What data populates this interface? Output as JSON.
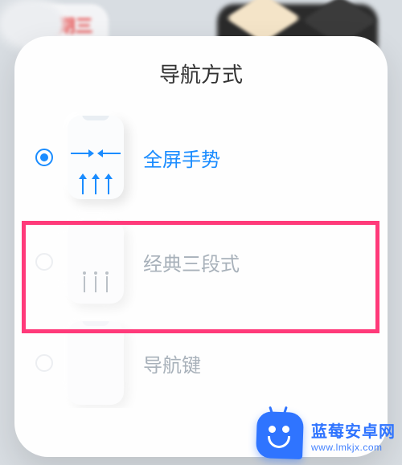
{
  "background": {
    "date_widget_label": "星期三"
  },
  "sheet": {
    "title": "导航方式",
    "options": [
      {
        "id": "fullscreen-gesture",
        "label": "全屏手势",
        "selected": true
      },
      {
        "id": "classic-three",
        "label": "经典三段式",
        "selected": false
      },
      {
        "id": "nav-keys",
        "label": "导航键",
        "selected": false
      }
    ]
  },
  "annotation": {
    "highlight_color": "#ff3a7a",
    "highlighted_option_id": "classic-three"
  },
  "watermark": {
    "brand": "蓝莓安卓网",
    "url": "www.lmkjx.com"
  }
}
